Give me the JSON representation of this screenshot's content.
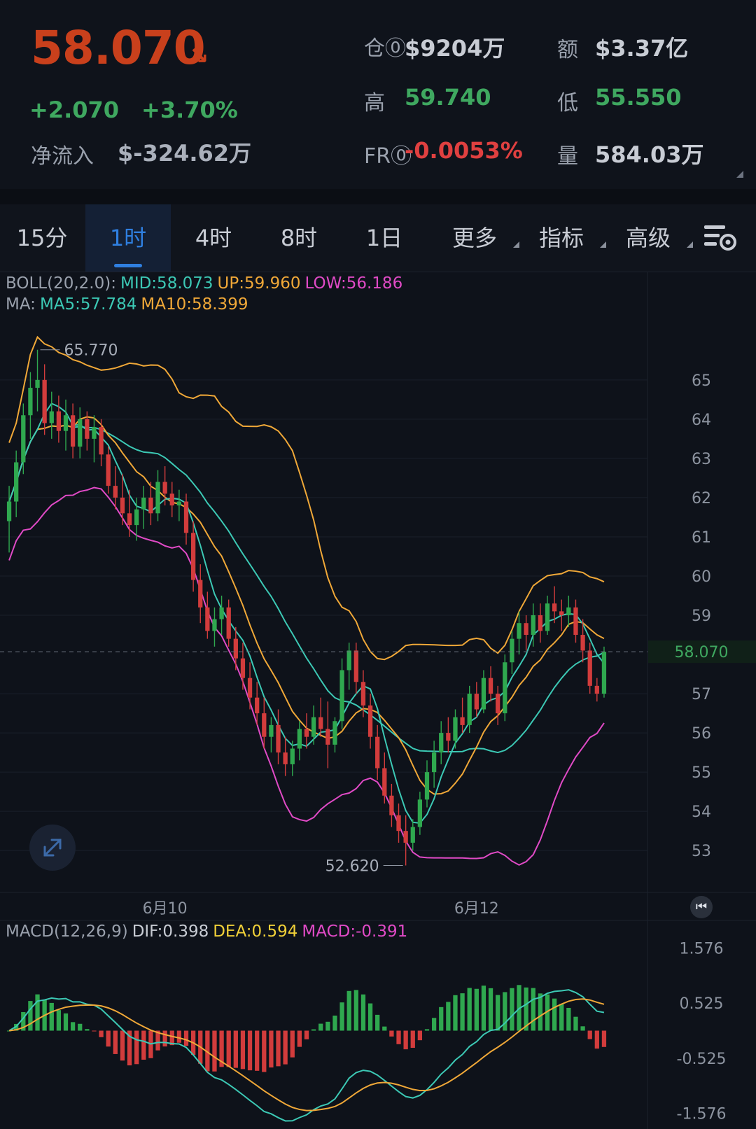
{
  "header": {
    "price": "58.070",
    "price_arrow": "↘",
    "change_abs": "+2.070",
    "change_pct": "+3.70%",
    "netflow_label": "净流入",
    "netflow_value": "$-324.62万",
    "stats": {
      "oi_label": "仓⓪",
      "oi_value": "$9204万",
      "amount_label": "额",
      "amount_value": "$3.37亿",
      "high_label": "高",
      "high_value": "59.740",
      "low_label": "低",
      "low_value": "55.550",
      "fr_label": "FR⓪",
      "fr_value": "-0.0053%",
      "vol_label": "量",
      "vol_value": "584.03万"
    }
  },
  "tabs": [
    {
      "label": "15分"
    },
    {
      "label": "1时",
      "active": true
    },
    {
      "label": "4时"
    },
    {
      "label": "8时"
    },
    {
      "label": "1日"
    },
    {
      "label": "更多"
    },
    {
      "label": "指标"
    },
    {
      "label": "高级"
    }
  ],
  "indicators": {
    "boll": {
      "name": "BOLL(20,2.0):",
      "mid": "MID:58.073",
      "up": "UP:59.960",
      "low": "LOW:56.186"
    },
    "ma": {
      "name": "MA:",
      "ma5": "MA5:57.784",
      "ma10": "MA10:58.399"
    },
    "macd": {
      "name": "MACD(12,26,9)",
      "dif": "DIF:0.398",
      "dea": "DEA:0.594",
      "macd": "MACD:-0.391"
    }
  },
  "colors": {
    "up": "#2fa84f",
    "down": "#d23c3c",
    "mid": "#3cc9b5",
    "upper": "#f0a838",
    "lower": "#e04ac6",
    "dif": "#3cc9b5",
    "dea": "#f0a838"
  },
  "chart_data": {
    "type": "candlestick",
    "price_axis": {
      "ticks": [
        "65",
        "64",
        "63",
        "62",
        "61",
        "60",
        "59",
        "57",
        "56",
        "55",
        "54",
        "53"
      ],
      "ylim": [
        52.2,
        66.3
      ]
    },
    "current_price": "58.070",
    "max_marker": "65.770",
    "min_marker": "52.620",
    "x_labels": [
      "6月10",
      "6月12"
    ],
    "candles": [
      [
        61.4,
        62.3,
        60.6,
        61.9
      ],
      [
        61.9,
        63.2,
        61.5,
        62.9
      ],
      [
        62.9,
        64.4,
        62.6,
        64.1
      ],
      [
        64.1,
        65.2,
        63.5,
        64.8
      ],
      [
        64.8,
        65.77,
        64.2,
        65.0
      ],
      [
        65.0,
        65.4,
        63.6,
        63.9
      ],
      [
        63.9,
        64.7,
        63.5,
        64.2
      ],
      [
        64.2,
        64.6,
        63.4,
        63.7
      ],
      [
        63.7,
        64.5,
        63.2,
        64.1
      ],
      [
        64.1,
        64.4,
        63.0,
        63.3
      ],
      [
        63.3,
        64.3,
        63.0,
        64.0
      ],
      [
        64.0,
        64.2,
        63.2,
        63.5
      ],
      [
        63.5,
        64.1,
        62.9,
        63.8
      ],
      [
        63.8,
        64.0,
        62.8,
        63.1
      ],
      [
        63.1,
        63.3,
        62.1,
        62.3
      ],
      [
        62.3,
        62.8,
        61.7,
        62.0
      ],
      [
        62.0,
        62.6,
        61.3,
        61.6
      ],
      [
        61.6,
        62.2,
        61.0,
        61.3
      ],
      [
        61.3,
        62.0,
        60.9,
        61.7
      ],
      [
        61.7,
        62.3,
        61.2,
        62.0
      ],
      [
        62.0,
        62.4,
        61.3,
        61.6
      ],
      [
        61.6,
        62.7,
        61.4,
        62.4
      ],
      [
        62.4,
        62.8,
        61.8,
        62.1
      ],
      [
        62.1,
        62.4,
        61.5,
        61.8
      ],
      [
        61.8,
        62.2,
        61.4,
        61.9
      ],
      [
        61.9,
        62.1,
        60.8,
        61.1
      ],
      [
        61.1,
        61.4,
        59.6,
        59.9
      ],
      [
        59.9,
        60.3,
        58.8,
        59.2
      ],
      [
        59.2,
        59.6,
        58.4,
        58.6
      ],
      [
        58.6,
        59.2,
        58.2,
        58.9
      ],
      [
        58.9,
        59.5,
        58.5,
        59.2
      ],
      [
        59.2,
        59.4,
        58.2,
        58.4
      ],
      [
        58.4,
        58.7,
        57.6,
        57.9
      ],
      [
        57.9,
        58.3,
        57.1,
        57.4
      ],
      [
        57.4,
        57.8,
        56.6,
        56.9
      ],
      [
        56.9,
        57.3,
        56.2,
        56.5
      ],
      [
        56.5,
        56.9,
        55.6,
        55.9
      ],
      [
        55.9,
        56.4,
        55.5,
        56.2
      ],
      [
        56.2,
        56.6,
        55.2,
        55.5
      ],
      [
        55.5,
        55.9,
        54.9,
        55.2
      ],
      [
        55.2,
        55.8,
        54.9,
        55.6
      ],
      [
        55.6,
        56.3,
        55.3,
        56.1
      ],
      [
        56.1,
        56.5,
        55.6,
        55.9
      ],
      [
        55.9,
        56.7,
        55.7,
        56.4
      ],
      [
        56.4,
        56.9,
        55.9,
        56.1
      ],
      [
        56.1,
        56.8,
        55.1,
        55.7
      ],
      [
        55.7,
        56.4,
        55.5,
        56.3
      ],
      [
        56.3,
        57.9,
        56.1,
        57.6
      ],
      [
        57.6,
        58.3,
        57.1,
        58.1
      ],
      [
        58.1,
        58.3,
        57.0,
        57.3
      ],
      [
        57.3,
        57.6,
        56.4,
        56.7
      ],
      [
        56.7,
        57.0,
        55.6,
        55.9
      ],
      [
        55.9,
        56.2,
        54.8,
        55.1
      ],
      [
        55.1,
        55.5,
        54.2,
        54.4
      ],
      [
        54.4,
        54.7,
        53.6,
        53.9
      ],
      [
        53.9,
        54.2,
        53.2,
        53.5
      ],
      [
        53.5,
        53.9,
        52.62,
        53.2
      ],
      [
        53.2,
        53.8,
        53.0,
        53.6
      ],
      [
        53.6,
        54.5,
        53.4,
        54.3
      ],
      [
        54.3,
        55.3,
        54.1,
        55.0
      ],
      [
        55.0,
        55.8,
        54.6,
        55.5
      ],
      [
        55.5,
        56.3,
        55.2,
        56.0
      ],
      [
        56.0,
        56.4,
        55.5,
        55.8
      ],
      [
        55.8,
        56.6,
        55.6,
        56.4
      ],
      [
        56.4,
        56.9,
        56.0,
        56.2
      ],
      [
        56.2,
        57.2,
        56.0,
        57.0
      ],
      [
        57.0,
        57.3,
        56.4,
        56.6
      ],
      [
        56.6,
        57.6,
        56.5,
        57.4
      ],
      [
        57.4,
        57.7,
        56.8,
        57.0
      ],
      [
        57.0,
        57.2,
        56.2,
        56.5
      ],
      [
        56.5,
        58.0,
        56.3,
        57.8
      ],
      [
        57.8,
        58.6,
        57.5,
        58.4
      ],
      [
        58.4,
        59.1,
        58.0,
        58.8
      ],
      [
        58.8,
        59.0,
        58.1,
        58.5
      ],
      [
        58.5,
        59.3,
        58.2,
        59.0
      ],
      [
        59.0,
        59.3,
        58.3,
        58.6
      ],
      [
        58.6,
        59.5,
        58.5,
        59.3
      ],
      [
        59.3,
        59.74,
        58.8,
        59.1
      ],
      [
        59.1,
        59.4,
        58.6,
        59.0
      ],
      [
        59.0,
        59.5,
        58.7,
        59.2
      ],
      [
        59.2,
        59.4,
        58.3,
        58.5
      ],
      [
        58.5,
        58.9,
        57.8,
        58.1
      ],
      [
        58.1,
        58.3,
        57.0,
        57.2
      ],
      [
        57.2,
        57.4,
        56.8,
        57.0
      ],
      [
        57.0,
        58.2,
        56.9,
        58.07
      ]
    ]
  },
  "macd_axis": {
    "ticks": [
      "1.576",
      "0.525",
      "-0.525",
      "-1.576"
    ],
    "ylim": [
      -1.7,
      1.7
    ]
  }
}
